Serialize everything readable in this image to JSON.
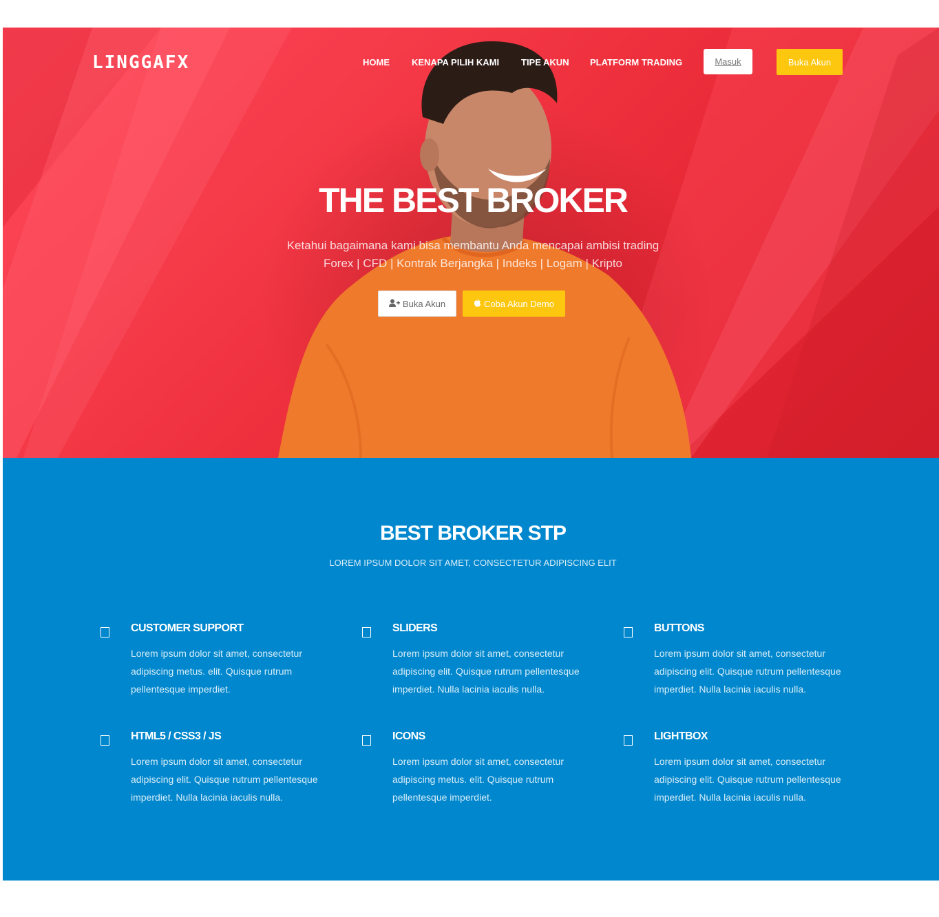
{
  "nav": {
    "logo": "LINGGAFX",
    "links": [
      "HOME",
      "KENAPA PILIH KAMI",
      "TIPE AKUN",
      "PLATFORM TRADING"
    ],
    "login_label": "Masuk",
    "open_account_label": "Buka Akun"
  },
  "hero": {
    "title": "THE BEST BROKER",
    "subtitle_line1": "Ketahui bagaimana kami bisa membantu Anda mencapai ambisi trading",
    "subtitle_line2": "Forex | CFD | Kontrak Berjangka | Indeks | Logam | Kripto",
    "open_account_label": "Buka Akun",
    "demo_label": "Coba Akun Demo"
  },
  "features": {
    "title": "BEST BROKER STP",
    "subtitle": "LOREM IPSUM DOLOR SIT AMET, CONSECTETUR ADIPISCING ELIT",
    "items": [
      {
        "title": "CUSTOMER SUPPORT",
        "text": "Lorem ipsum dolor sit amet, consectetur adipiscing metus. elit. Quisque rutrum pellentesque imperdiet."
      },
      {
        "title": "SLIDERS",
        "text": "Lorem ipsum dolor sit amet, consectetur adipiscing elit. Quisque rutrum pellentesque imperdiet. Nulla lacinia iaculis nulla."
      },
      {
        "title": "BUTTONS",
        "text": "Lorem ipsum dolor sit amet, consectetur adipiscing elit. Quisque rutrum pellentesque imperdiet. Nulla lacinia iaculis nulla."
      },
      {
        "title": "HTML5 / CSS3 / JS",
        "text": "Lorem ipsum dolor sit amet, consectetur adipiscing elit. Quisque rutrum pellentesque imperdiet. Nulla lacinia iaculis nulla."
      },
      {
        "title": "ICONS",
        "text": "Lorem ipsum dolor sit amet, consectetur adipiscing metus. elit. Quisque rutrum pellentesque imperdiet."
      },
      {
        "title": "LIGHTBOX",
        "text": "Lorem ipsum dolor sit amet, consectetur adipiscing elit. Quisque rutrum pellentesque imperdiet. Nulla lacinia iaculis nulla."
      }
    ]
  },
  "colors": {
    "hero_red": "#f0323f",
    "accent_yellow": "#fdc70f",
    "features_blue": "#0087cd",
    "shirt_orange": "#f07a2c"
  },
  "icons": {
    "open_account": "user-plus-icon",
    "demo": "apple-icon",
    "feature": "feature-square-icon"
  }
}
